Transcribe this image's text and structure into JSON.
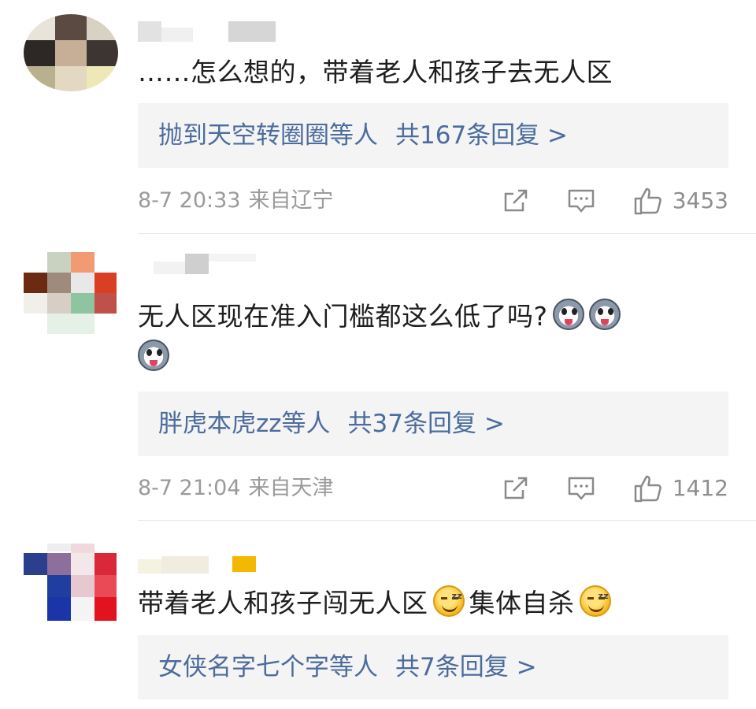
{
  "comments": [
    {
      "text": "……怎么想的，带着老人和孩子去无人区",
      "replies_by": "抛到天空转圈圈等人",
      "replies_count": "共167条回复 >",
      "time": "8-7 20:33",
      "source": "来自辽宁",
      "likes": "3453",
      "avatar": "pixelated-avatar"
    },
    {
      "text": "无人区现在准入门槛都这么低了吗?",
      "emojis": [
        "husky-emoji",
        "husky-emoji",
        "husky-emoji"
      ],
      "replies_by": "胖虎本虎zz等人",
      "replies_count": "共37条回复 >",
      "time": "8-7 21:04",
      "source": "来自天津",
      "likes": "1412",
      "avatar": "pixelated-avatar"
    },
    {
      "text_a": "带着老人和孩子闯无人区",
      "text_b": "集体自杀",
      "emojis": [
        "sleepy-smile-emoji",
        "sleepy-smile-emoji"
      ],
      "replies_by": "女侠名字七个字等人",
      "replies_count": "共7条回复 >",
      "avatar": "pixelated-avatar"
    }
  ],
  "colors": {
    "reply_link": "#4b6c9c",
    "reply_bg": "#f4f4f5",
    "meta_text": "#9a9a9a",
    "body_text": "#1e1e1e"
  },
  "icons": [
    "share-icon",
    "comment-icon",
    "like-icon"
  ]
}
